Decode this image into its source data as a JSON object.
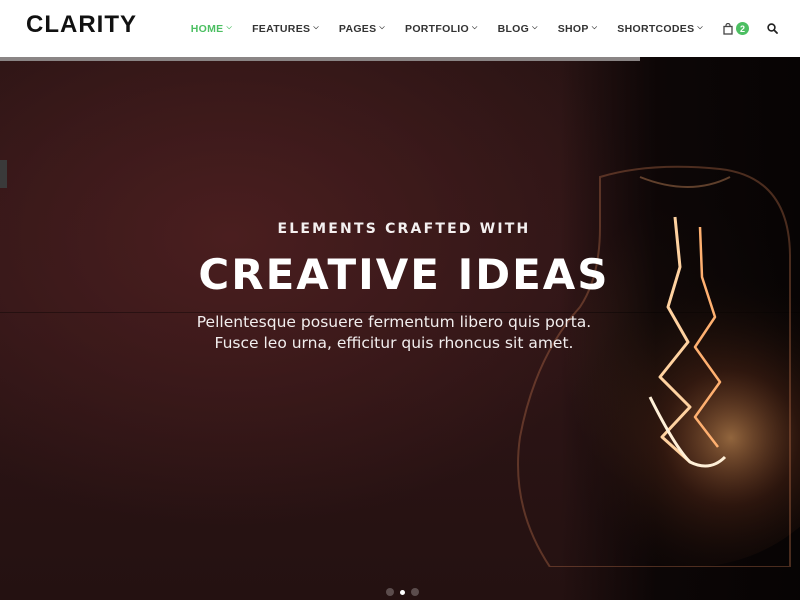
{
  "brand": {
    "logo_text": "CLARITY"
  },
  "nav": {
    "items": [
      {
        "label": "HOME",
        "active": true
      },
      {
        "label": "FEATURES",
        "active": false
      },
      {
        "label": "PAGES",
        "active": false
      },
      {
        "label": "PORTFOLIO",
        "active": false
      },
      {
        "label": "BLOG",
        "active": false
      },
      {
        "label": "SHOP",
        "active": false
      },
      {
        "label": "SHORTCODES",
        "active": false
      }
    ],
    "cart_count": "2",
    "cart_icon": "shopping-bag-icon",
    "search_icon": "search-icon",
    "chevron_icon": "chevron-down-icon",
    "accent_color": "#4cbf62"
  },
  "hero": {
    "eyebrow": "ELEMENTS CRAFTED WITH",
    "headline": "CREATIVE IDEAS",
    "subtitle_line1": "Pellentesque posuere fermentum libero quis porta.",
    "subtitle_line2": "Fusce leo urna, efficitur quis rhoncus sit amet.",
    "slide_progress_percent": 80,
    "slides_total": 3,
    "active_slide": 2
  }
}
